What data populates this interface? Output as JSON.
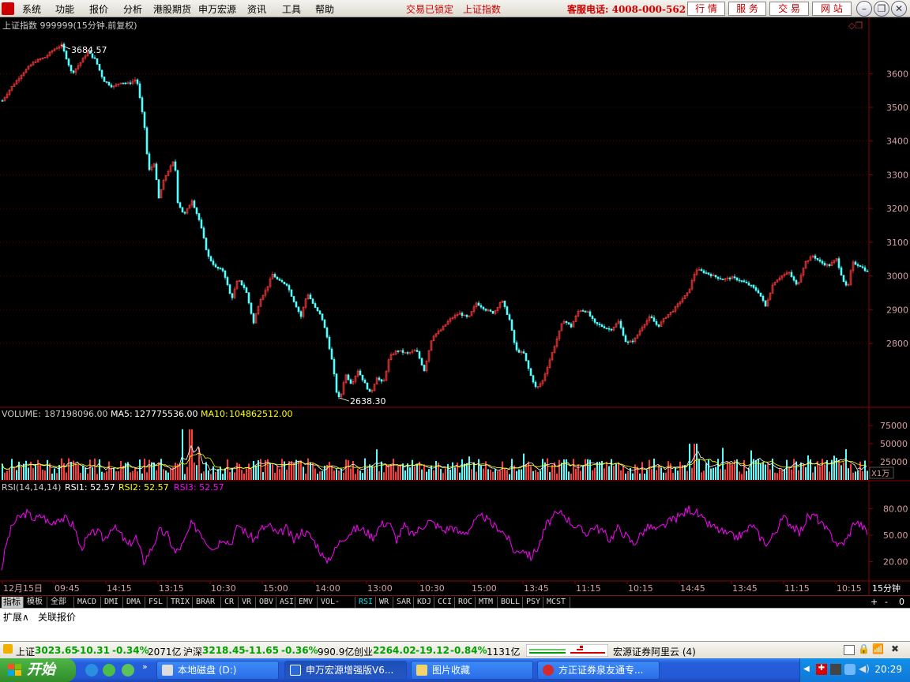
{
  "menu": {
    "items": [
      "系统",
      "功能",
      "报价",
      "分析",
      "港股期货",
      "申万宏源",
      "资讯",
      "工具",
      "帮助"
    ],
    "lock_status": "交易已锁定",
    "current_index": "上证指数",
    "hotline": "客服电话: 4008-000-562",
    "top_buttons": [
      "行 情",
      "服 务",
      "交 易",
      "网 站"
    ]
  },
  "chart_data": {
    "type": "line",
    "title": "上证指数 999999(15分钟.前复权)",
    "price_axis": {
      "ticks": [
        2800,
        2900,
        3000,
        3100,
        3200,
        3300,
        3400,
        3500,
        3600
      ],
      "ylim": [
        2620,
        3720
      ]
    },
    "price_series": {
      "name": "上证指数",
      "points": [
        [
          0,
          3520
        ],
        [
          10,
          3555
        ],
        [
          25,
          3600
        ],
        [
          40,
          3635
        ],
        [
          55,
          3650
        ],
        [
          65,
          3672
        ],
        [
          75,
          3684.57
        ],
        [
          82,
          3640
        ],
        [
          88,
          3600
        ],
        [
          98,
          3630
        ],
        [
          108,
          3665
        ],
        [
          118,
          3640
        ],
        [
          128,
          3580
        ],
        [
          140,
          3560
        ],
        [
          150,
          3575
        ],
        [
          160,
          3570
        ],
        [
          170,
          3585
        ],
        [
          180,
          3440
        ],
        [
          185,
          3310
        ],
        [
          192,
          3335
        ],
        [
          198,
          3230
        ],
        [
          205,
          3290
        ],
        [
          212,
          3320
        ],
        [
          218,
          3345
        ],
        [
          222,
          3220
        ],
        [
          230,
          3180
        ],
        [
          240,
          3225
        ],
        [
          250,
          3160
        ],
        [
          260,
          3060
        ],
        [
          270,
          3025
        ],
        [
          280,
          3015
        ],
        [
          290,
          2930
        ],
        [
          298,
          2990
        ],
        [
          308,
          2960
        ],
        [
          318,
          2860
        ],
        [
          326,
          2930
        ],
        [
          334,
          2960
        ],
        [
          342,
          3005
        ],
        [
          350,
          2985
        ],
        [
          360,
          2975
        ],
        [
          370,
          2920
        ],
        [
          378,
          2880
        ],
        [
          386,
          2950
        ],
        [
          396,
          2905
        ],
        [
          404,
          2880
        ],
        [
          412,
          2810
        ],
        [
          418,
          2740
        ],
        [
          424,
          2640
        ],
        [
          428,
          2638.3
        ],
        [
          434,
          2710
        ],
        [
          442,
          2680
        ],
        [
          450,
          2720
        ],
        [
          458,
          2685
        ],
        [
          466,
          2650
        ],
        [
          474,
          2700
        ],
        [
          482,
          2680
        ],
        [
          490,
          2760
        ],
        [
          500,
          2780
        ],
        [
          512,
          2770
        ],
        [
          524,
          2780
        ],
        [
          534,
          2720
        ],
        [
          544,
          2820
        ],
        [
          555,
          2840
        ],
        [
          566,
          2870
        ],
        [
          578,
          2890
        ],
        [
          590,
          2875
        ],
        [
          600,
          2920
        ],
        [
          612,
          2900
        ],
        [
          622,
          2890
        ],
        [
          632,
          2930
        ],
        [
          642,
          2870
        ],
        [
          650,
          2780
        ],
        [
          660,
          2770
        ],
        [
          668,
          2710
        ],
        [
          676,
          2665
        ],
        [
          684,
          2690
        ],
        [
          692,
          2745
        ],
        [
          700,
          2800
        ],
        [
          710,
          2870
        ],
        [
          720,
          2850
        ],
        [
          730,
          2900
        ],
        [
          740,
          2895
        ],
        [
          750,
          2860
        ],
        [
          760,
          2850
        ],
        [
          770,
          2840
        ],
        [
          780,
          2865
        ],
        [
          790,
          2800
        ],
        [
          800,
          2810
        ],
        [
          810,
          2850
        ],
        [
          820,
          2880
        ],
        [
          830,
          2850
        ],
        [
          840,
          2880
        ],
        [
          850,
          2900
        ],
        [
          860,
          2930
        ],
        [
          868,
          2950
        ],
        [
          878,
          3020
        ],
        [
          890,
          3010
        ],
        [
          900,
          3000
        ],
        [
          912,
          2990
        ],
        [
          924,
          2995
        ],
        [
          936,
          2985
        ],
        [
          948,
          2970
        ],
        [
          958,
          2950
        ],
        [
          966,
          2910
        ],
        [
          976,
          2980
        ],
        [
          986,
          3000
        ],
        [
          996,
          3010
        ],
        [
          1006,
          2970
        ],
        [
          1016,
          3040
        ],
        [
          1026,
          3060
        ],
        [
          1036,
          3040
        ],
        [
          1046,
          3030
        ],
        [
          1056,
          3050
        ],
        [
          1064,
          2990
        ],
        [
          1070,
          2960
        ],
        [
          1076,
          3040
        ],
        [
          1086,
          3030
        ],
        [
          1096,
          3010
        ]
      ]
    },
    "annotations": [
      {
        "label": "3684.57",
        "x": 75,
        "value": 3684.57
      },
      {
        "label": "2638.30",
        "x": 428,
        "value": 2638.3
      }
    ],
    "volume": {
      "label": "VOLUME:",
      "value": "187198096.00",
      "ma5_label": "MA5:",
      "ma5": "127775536.00",
      "ma10_label": "MA10:",
      "ma10": "104862512.00",
      "ticks": [
        25000,
        50000,
        75000
      ],
      "unit": "X1万",
      "ylim": [
        0,
        85000
      ]
    },
    "rsi": {
      "label": "RSI(14,14,14)",
      "rsi1": "RSI1: 52.57",
      "rsi2": "RSI2: 52.57",
      "rsi3": "RSI3: 52.57",
      "ticks": [
        "20.00",
        "50.00",
        "80.00"
      ],
      "ylim": [
        0,
        100
      ],
      "points": [
        [
          0,
          12
        ],
        [
          6,
          40
        ],
        [
          14,
          62
        ],
        [
          22,
          70
        ],
        [
          32,
          75
        ],
        [
          42,
          68
        ],
        [
          52,
          72
        ],
        [
          62,
          62
        ],
        [
          72,
          70
        ],
        [
          82,
          68
        ],
        [
          92,
          60
        ],
        [
          100,
          35
        ],
        [
          110,
          48
        ],
        [
          120,
          55
        ],
        [
          130,
          45
        ],
        [
          140,
          60
        ],
        [
          150,
          52
        ],
        [
          160,
          38
        ],
        [
          170,
          48
        ],
        [
          180,
          20
        ],
        [
          190,
          35
        ],
        [
          200,
          55
        ],
        [
          210,
          50
        ],
        [
          220,
          30
        ],
        [
          230,
          40
        ],
        [
          240,
          62
        ],
        [
          250,
          56
        ],
        [
          260,
          42
        ],
        [
          270,
          35
        ],
        [
          280,
          48
        ],
        [
          290,
          40
        ],
        [
          300,
          62
        ],
        [
          310,
          52
        ],
        [
          320,
          45
        ],
        [
          330,
          58
        ],
        [
          340,
          60
        ],
        [
          350,
          50
        ],
        [
          360,
          58
        ],
        [
          370,
          44
        ],
        [
          380,
          55
        ],
        [
          390,
          50
        ],
        [
          400,
          38
        ],
        [
          410,
          20
        ],
        [
          420,
          30
        ],
        [
          430,
          45
        ],
        [
          440,
          52
        ],
        [
          450,
          58
        ],
        [
          460,
          55
        ],
        [
          470,
          48
        ],
        [
          480,
          62
        ],
        [
          490,
          65
        ],
        [
          500,
          45
        ],
        [
          510,
          60
        ],
        [
          520,
          50
        ],
        [
          530,
          58
        ],
        [
          540,
          66
        ],
        [
          550,
          62
        ],
        [
          560,
          55
        ],
        [
          570,
          60
        ],
        [
          580,
          52
        ],
        [
          590,
          55
        ],
        [
          600,
          66
        ],
        [
          610,
          72
        ],
        [
          620,
          62
        ],
        [
          630,
          58
        ],
        [
          640,
          48
        ],
        [
          650,
          30
        ],
        [
          660,
          35
        ],
        [
          670,
          25
        ],
        [
          680,
          38
        ],
        [
          690,
          62
        ],
        [
          700,
          72
        ],
        [
          710,
          75
        ],
        [
          720,
          65
        ],
        [
          730,
          58
        ],
        [
          740,
          52
        ],
        [
          750,
          60
        ],
        [
          760,
          55
        ],
        [
          770,
          45
        ],
        [
          780,
          58
        ],
        [
          790,
          50
        ],
        [
          800,
          40
        ],
        [
          810,
          52
        ],
        [
          820,
          60
        ],
        [
          830,
          55
        ],
        [
          840,
          62
        ],
        [
          850,
          68
        ],
        [
          860,
          72
        ],
        [
          870,
          80
        ],
        [
          880,
          75
        ],
        [
          890,
          65
        ],
        [
          900,
          60
        ],
        [
          910,
          55
        ],
        [
          920,
          50
        ],
        [
          930,
          48
        ],
        [
          940,
          52
        ],
        [
          950,
          62
        ],
        [
          960,
          48
        ],
        [
          970,
          40
        ],
        [
          980,
          55
        ],
        [
          990,
          70
        ],
        [
          1000,
          62
        ],
        [
          1010,
          52
        ],
        [
          1020,
          70
        ],
        [
          1030,
          72
        ],
        [
          1040,
          60
        ],
        [
          1050,
          50
        ],
        [
          1060,
          38
        ],
        [
          1070,
          45
        ],
        [
          1080,
          66
        ],
        [
          1090,
          60
        ],
        [
          1096,
          52
        ]
      ]
    },
    "x_labels": [
      "12月15日",
      "09:45",
      "14:15",
      "13:15",
      "10:30",
      "15:00",
      "14:00",
      "13:00",
      "10:30",
      "15:00",
      "13:45",
      "11:15",
      "10:15",
      "14:45",
      "13:45",
      "11:15",
      "10:15"
    ],
    "period": "15分钟"
  },
  "indicator_tabs": [
    "指标",
    "模板",
    "全部",
    "MACD",
    "DMI",
    "DMA",
    "FSL",
    "TRIX",
    "BRAR",
    "CR",
    "VR",
    "OBV",
    "ASI",
    "EMV",
    "VOL-TDX",
    "RSI",
    "WR",
    "SAR",
    "KDJ",
    "CCI",
    "ROC",
    "MTM",
    "BOLL",
    "PSY",
    "MCST"
  ],
  "selected_indicator": "RSI",
  "nav_symbols": [
    "+",
    "-",
    "0"
  ],
  "ext_tabs": [
    "扩展∧",
    "关联报价"
  ],
  "statusbar": {
    "sh_label": "上证",
    "sh_value": "3023.65",
    "sh_change": "-10.31",
    "sh_pct": "-0.34%",
    "sh_amount": "2071亿",
    "hs_label": "沪深",
    "hs_value": "3218.45",
    "hs_change": "-11.65",
    "hs_pct": "-0.36%",
    "hs_amount": "990.9亿",
    "cy_label": "创业",
    "cy_value": "2264.02",
    "cy_change": "-19.12",
    "cy_pct": "-0.84%",
    "cy_amount": "1131亿",
    "broker": "宏源证券阿里云 (4)"
  },
  "taskbar": {
    "start": "开始",
    "apps": [
      "本地磁盘 (D:)",
      "申万宏源增强版V6...",
      "图片收藏",
      "方正证券泉友通专..."
    ],
    "clock": "20:29"
  },
  "colors": {
    "up": "#ff3c3c",
    "down": "#54ffff",
    "rsi": "#ff00ff",
    "grid": "#8b0000",
    "axis_text": "#d8a0a0",
    "ma5": "#ffffff",
    "ma10": "#ffff00"
  }
}
